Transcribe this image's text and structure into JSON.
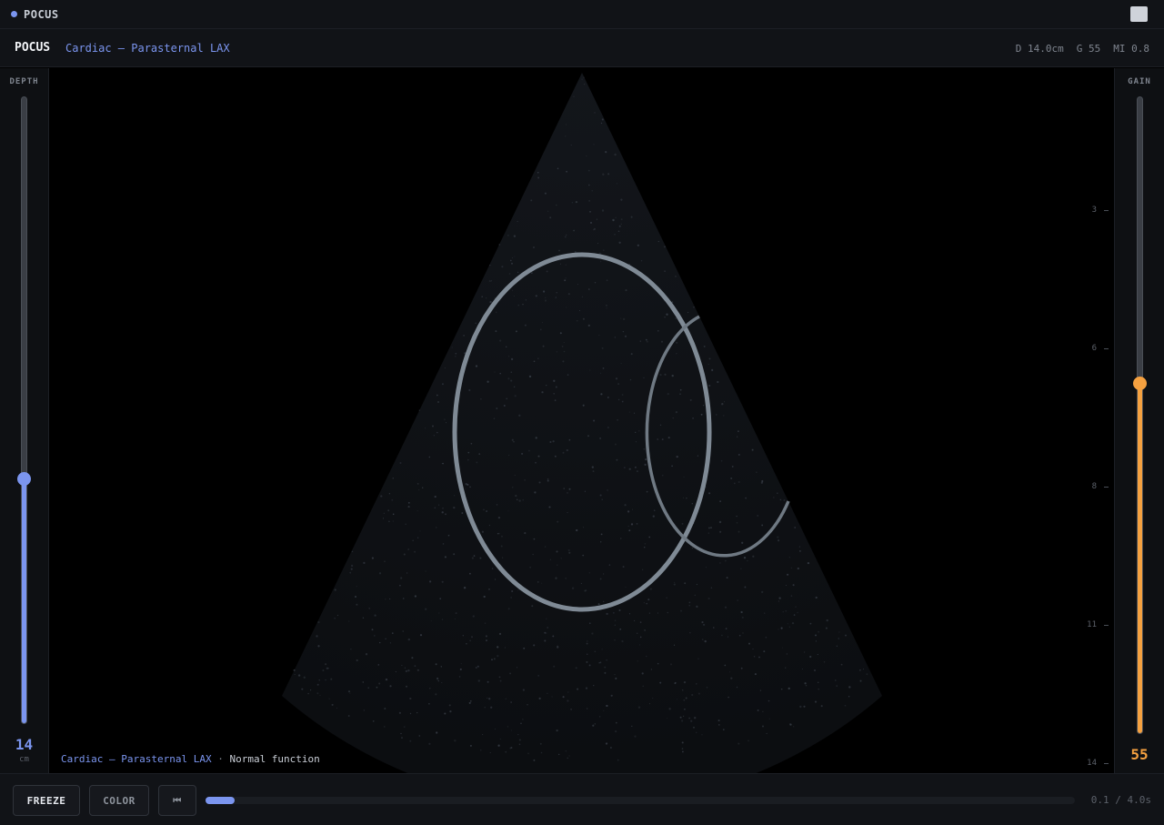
{
  "window": {
    "title": "POCUS",
    "accent": "#7b95ef"
  },
  "header": {
    "brand": "POCUS",
    "preset": "Cardiac — Parasternal LAX",
    "readouts": {
      "depth": "D 14.0cm",
      "gain": "G 55",
      "mi": "MI 0.8"
    }
  },
  "depth_control": {
    "label": "DEPTH",
    "value": "14",
    "unit": "cm",
    "level_fraction": 0.39,
    "color": "#7b95ef"
  },
  "gain_control": {
    "label": "GAIN",
    "value": "55",
    "level_fraction": 0.55,
    "color": "#f5a140"
  },
  "depth_scale": [
    "3",
    "6",
    "8",
    "11",
    "14"
  ],
  "caption": {
    "preset": "Cardiac — Parasternal LAX",
    "separator": "·",
    "status": "Normal function"
  },
  "controls": {
    "freeze_label": "FREEZE",
    "color_label": "COLOR",
    "rewind_glyph": "⏮",
    "progress_fraction": 0.033,
    "timecode": "0.1 / 4.0s"
  }
}
